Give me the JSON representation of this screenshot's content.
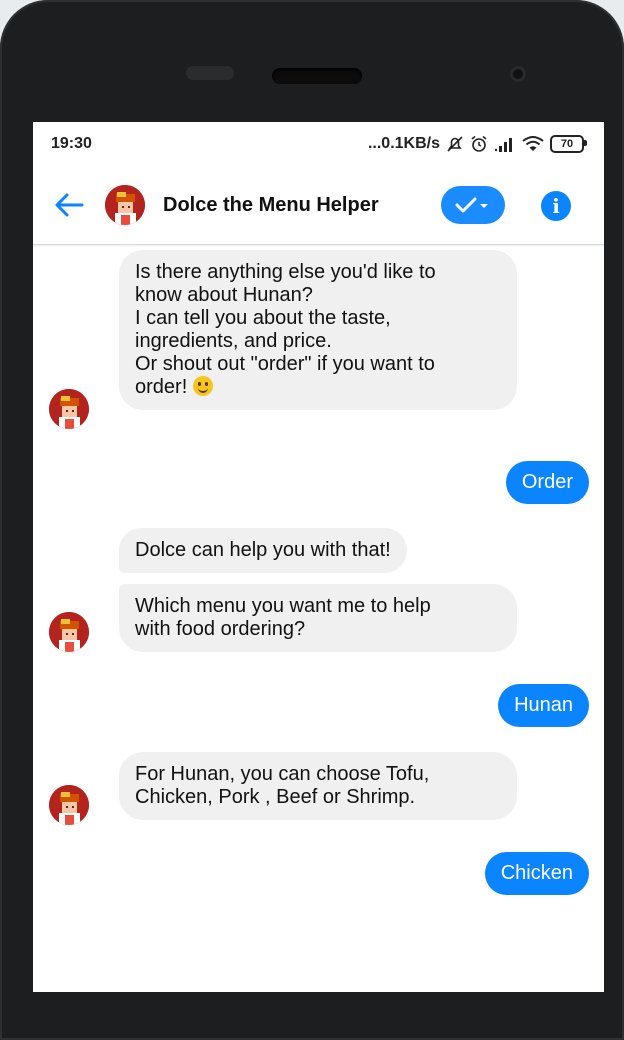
{
  "status_bar": {
    "time": "19:30",
    "network_speed": "...0.1KB/s",
    "battery_level": "70",
    "icons": [
      "mute-icon",
      "alarm-icon",
      "signal-icon",
      "wifi-icon",
      "battery-icon"
    ]
  },
  "header": {
    "title": "Dolce the Menu Helper",
    "back_icon": "arrow-left-icon",
    "verified_icon": "checkmark-dropdown-icon",
    "info_icon": "info-icon",
    "info_glyph": "i"
  },
  "messages": [
    {
      "from": "bot",
      "lines": [
        "Is there anything else you'd like to",
        "know about Hunan?",
        "I can tell you about the taste,",
        "ingredients, and price.",
        "Or shout out \"order\" if you want to",
        "order!"
      ],
      "emoji": "smile-emoji"
    },
    {
      "from": "user",
      "text": "Order"
    },
    {
      "from": "bot",
      "text": "Dolce can help you with that!"
    },
    {
      "from": "bot",
      "lines": [
        "Which menu you want me to help",
        "with food ordering?"
      ]
    },
    {
      "from": "user",
      "text": "Hunan"
    },
    {
      "from": "bot",
      "lines": [
        "For Hunan, you can choose Tofu,",
        "Chicken, Pork , Beef or Shrimp."
      ]
    },
    {
      "from": "user",
      "text": "Chicken"
    }
  ],
  "colors": {
    "accent": "#0a84ff",
    "bot_bubble": "#f0f0f0",
    "avatar_bg": "#b3241f"
  }
}
